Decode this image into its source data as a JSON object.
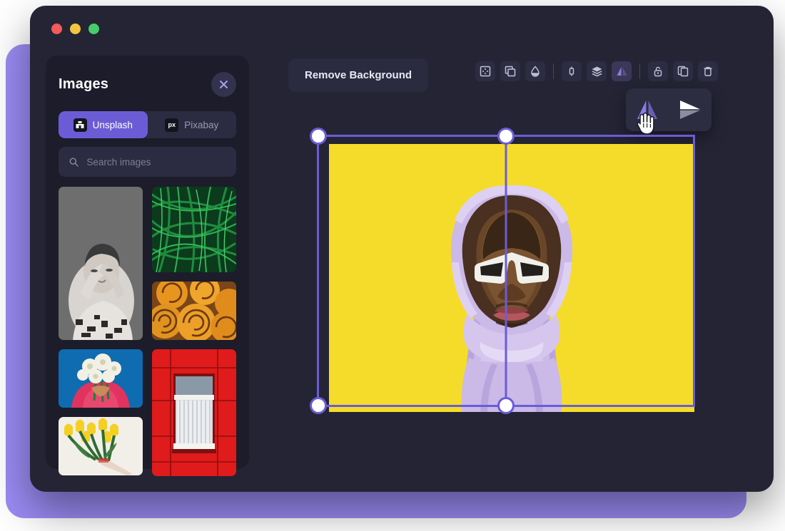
{
  "window": {
    "traffic_lights": [
      {
        "name": "close",
        "color": "#f4595b"
      },
      {
        "name": "minimize",
        "color": "#f5c542"
      },
      {
        "name": "maximize",
        "color": "#46cc6b"
      }
    ],
    "backdrop_color": "#9b8cf5",
    "chrome_color": "#242435"
  },
  "sidebar": {
    "title": "Images",
    "close_label": "×",
    "accent_color": "#6b5cd6",
    "tabs": [
      {
        "label": "Unsplash",
        "icon": "unsplash-icon",
        "active": true
      },
      {
        "label": "Pixabay",
        "icon": "pixabay-icon",
        "active": false
      }
    ],
    "search": {
      "placeholder": "Search images",
      "value": "",
      "icon": "search-icon"
    },
    "thumbnails": [
      {
        "name": "thumb-portrait-bw",
        "alt": "Black and white portrait of woman with arms raised"
      },
      {
        "name": "thumb-flowers-blue",
        "alt": "Person in pink shirt holding white flowers on blue background"
      },
      {
        "name": "thumb-tulips",
        "alt": "Bouquet of yellow tulips"
      },
      {
        "name": "thumb-grass",
        "alt": "Close-up of green grass blades"
      },
      {
        "name": "thumb-cinnamon-buns",
        "alt": "Golden cinnamon buns"
      },
      {
        "name": "thumb-red-window",
        "alt": "White window on red tiled wall"
      }
    ]
  },
  "canvas": {
    "remove_bg_label": "Remove Background",
    "toolbar": [
      {
        "name": "crop-icon",
        "label": "Crop",
        "active": false
      },
      {
        "name": "duplicate-layer-icon",
        "label": "Duplicate",
        "active": false
      },
      {
        "name": "opacity-droplet-icon",
        "label": "Opacity",
        "active": false
      },
      {
        "name": "separator-1",
        "label": "",
        "active": false
      },
      {
        "name": "align-vertical-icon",
        "label": "Align",
        "active": false
      },
      {
        "name": "layers-icon",
        "label": "Layers",
        "active": false
      },
      {
        "name": "flip-icon",
        "label": "Flip",
        "active": true
      },
      {
        "name": "separator-2",
        "label": "",
        "active": false
      },
      {
        "name": "unlock-icon",
        "label": "Lock",
        "active": false
      },
      {
        "name": "copy-icon",
        "label": "Copy",
        "active": false
      },
      {
        "name": "trash-icon",
        "label": "Delete",
        "active": false
      }
    ],
    "flip_menu": {
      "options": [
        {
          "name": "flip-horizontal-icon",
          "label": "Flip horizontal",
          "highlighted": true
        },
        {
          "name": "flip-vertical-icon",
          "label": "Flip vertical",
          "highlighted": false
        }
      ]
    },
    "artwork": {
      "alt": "Man in lavender hoodie with white sunglasses on yellow background, mirrored horizontally",
      "background_color": "#f5dc2b",
      "hoodie_color": "#cbb9e8",
      "selected": true
    },
    "selection": {
      "border_color": "#6b5cd6",
      "handles": [
        "top-left",
        "top-middle",
        "bottom-left",
        "bottom-middle"
      ]
    }
  }
}
